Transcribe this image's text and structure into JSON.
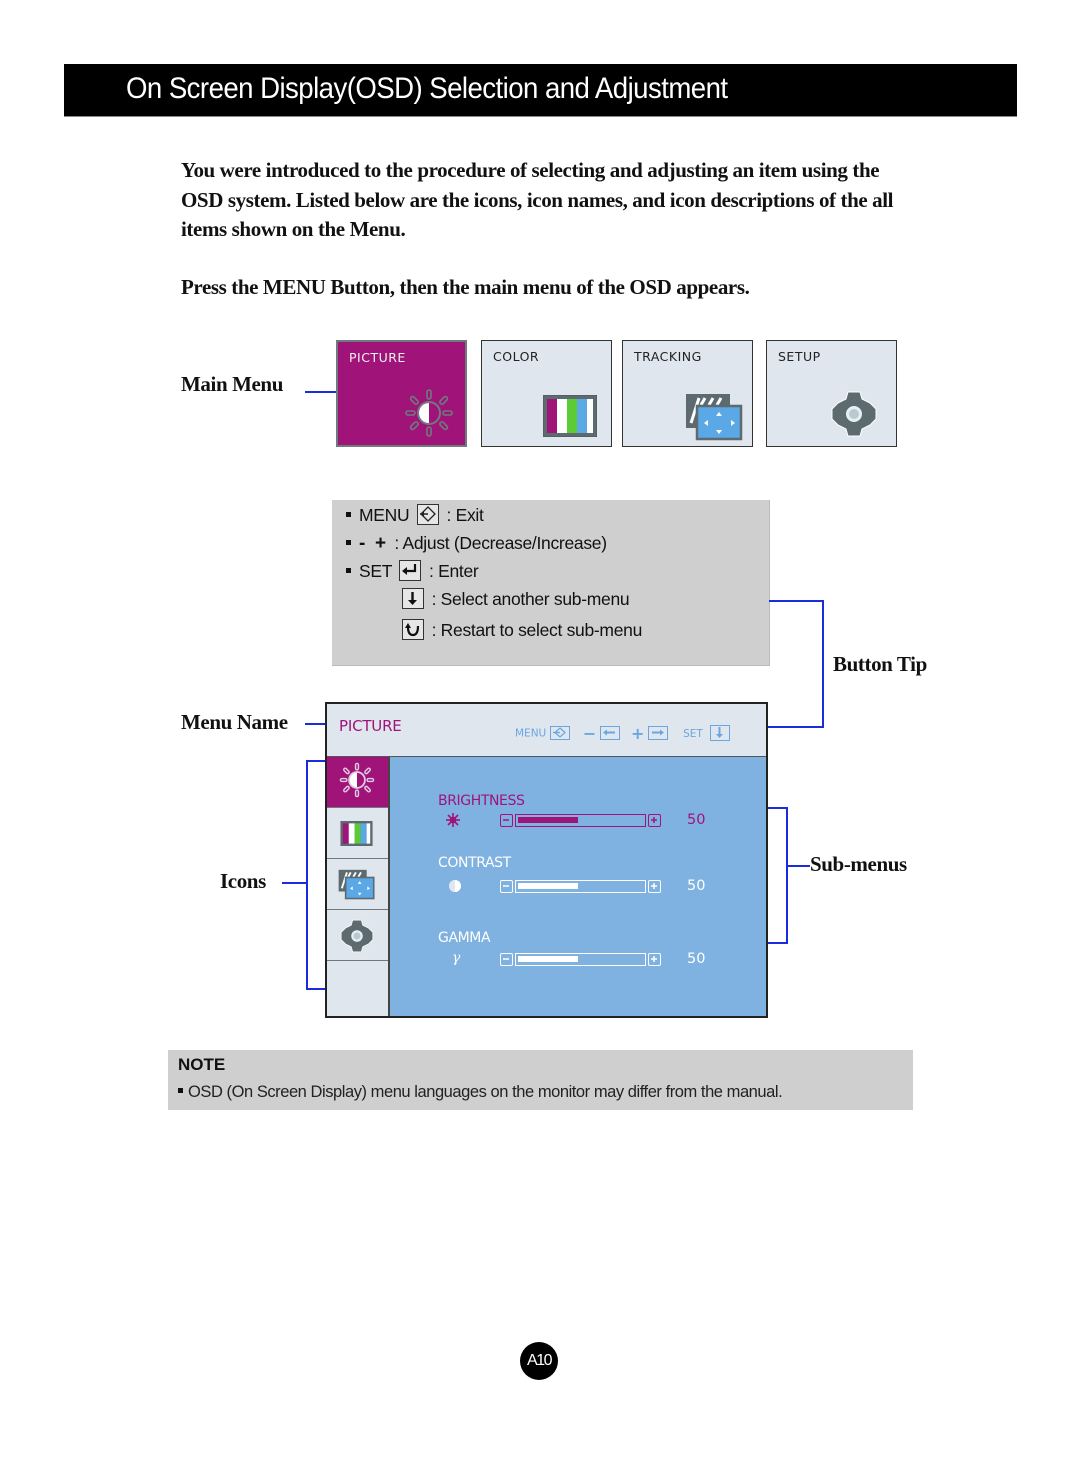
{
  "page": {
    "title": "On Screen Display(OSD) Selection and Adjustment",
    "intro": "You were introduced to the procedure of selecting and adjusting an item using the OSD system.  Listed below are the icons, icon names, and icon descriptions of the all items shown on the Menu.",
    "press_instruction": "Press the MENU Button, then the main menu of the OSD appears.",
    "page_number": "A10"
  },
  "callouts": {
    "main_menu": "Main Menu",
    "menu_name": "Menu Name",
    "icons": "Icons",
    "button_tip": "Button Tip",
    "sub_menus": "Sub-menus"
  },
  "main_menu": {
    "tiles": [
      {
        "label": "PICTURE",
        "icon": "brightness-contrast-icon",
        "active": true
      },
      {
        "label": "COLOR",
        "icon": "color-bars-icon",
        "active": false
      },
      {
        "label": "TRACKING",
        "icon": "tracking-position-icon",
        "active": false
      },
      {
        "label": "SETUP",
        "icon": "gear-icon",
        "active": false
      }
    ]
  },
  "button_tips": {
    "rows": [
      {
        "key": "MENU",
        "icon": "exit-icon",
        "desc": ": Exit"
      },
      {
        "key": "-  +",
        "icon": "",
        "desc": ": Adjust (Decrease/Increase)"
      },
      {
        "key": "SET",
        "icon": "enter-icon",
        "desc": ": Enter"
      },
      {
        "key": "",
        "icon": "down-arrow-icon",
        "desc": ": Select another sub-menu"
      },
      {
        "key": "",
        "icon": "restart-icon",
        "desc": ": Restart to select sub-menu"
      }
    ]
  },
  "osd": {
    "menu_name": "PICTURE",
    "header_keys": {
      "menu": "MENU",
      "minus": "−",
      "plus": "+",
      "set": "SET"
    },
    "submenus": [
      {
        "label": "BRIGHTNESS",
        "icon": "sun-icon",
        "value": 50,
        "display_value": "50",
        "active": true
      },
      {
        "label": "CONTRAST",
        "icon": "contrast-icon",
        "value": 50,
        "display_value": "50",
        "active": false
      },
      {
        "label": "GAMMA",
        "icon": "gamma-icon",
        "value": 50,
        "display_value": "50",
        "active": false
      }
    ],
    "slider_max": 100
  },
  "note": {
    "title": "NOTE",
    "text": "OSD (On Screen Display) menu languages on the monitor may differ from the manual."
  },
  "colors": {
    "accent_magenta": "#a0147a",
    "osd_blue": "#7fb2e0",
    "callout_blue": "#1a2be0",
    "tile_gray": "#dfe6ed"
  }
}
